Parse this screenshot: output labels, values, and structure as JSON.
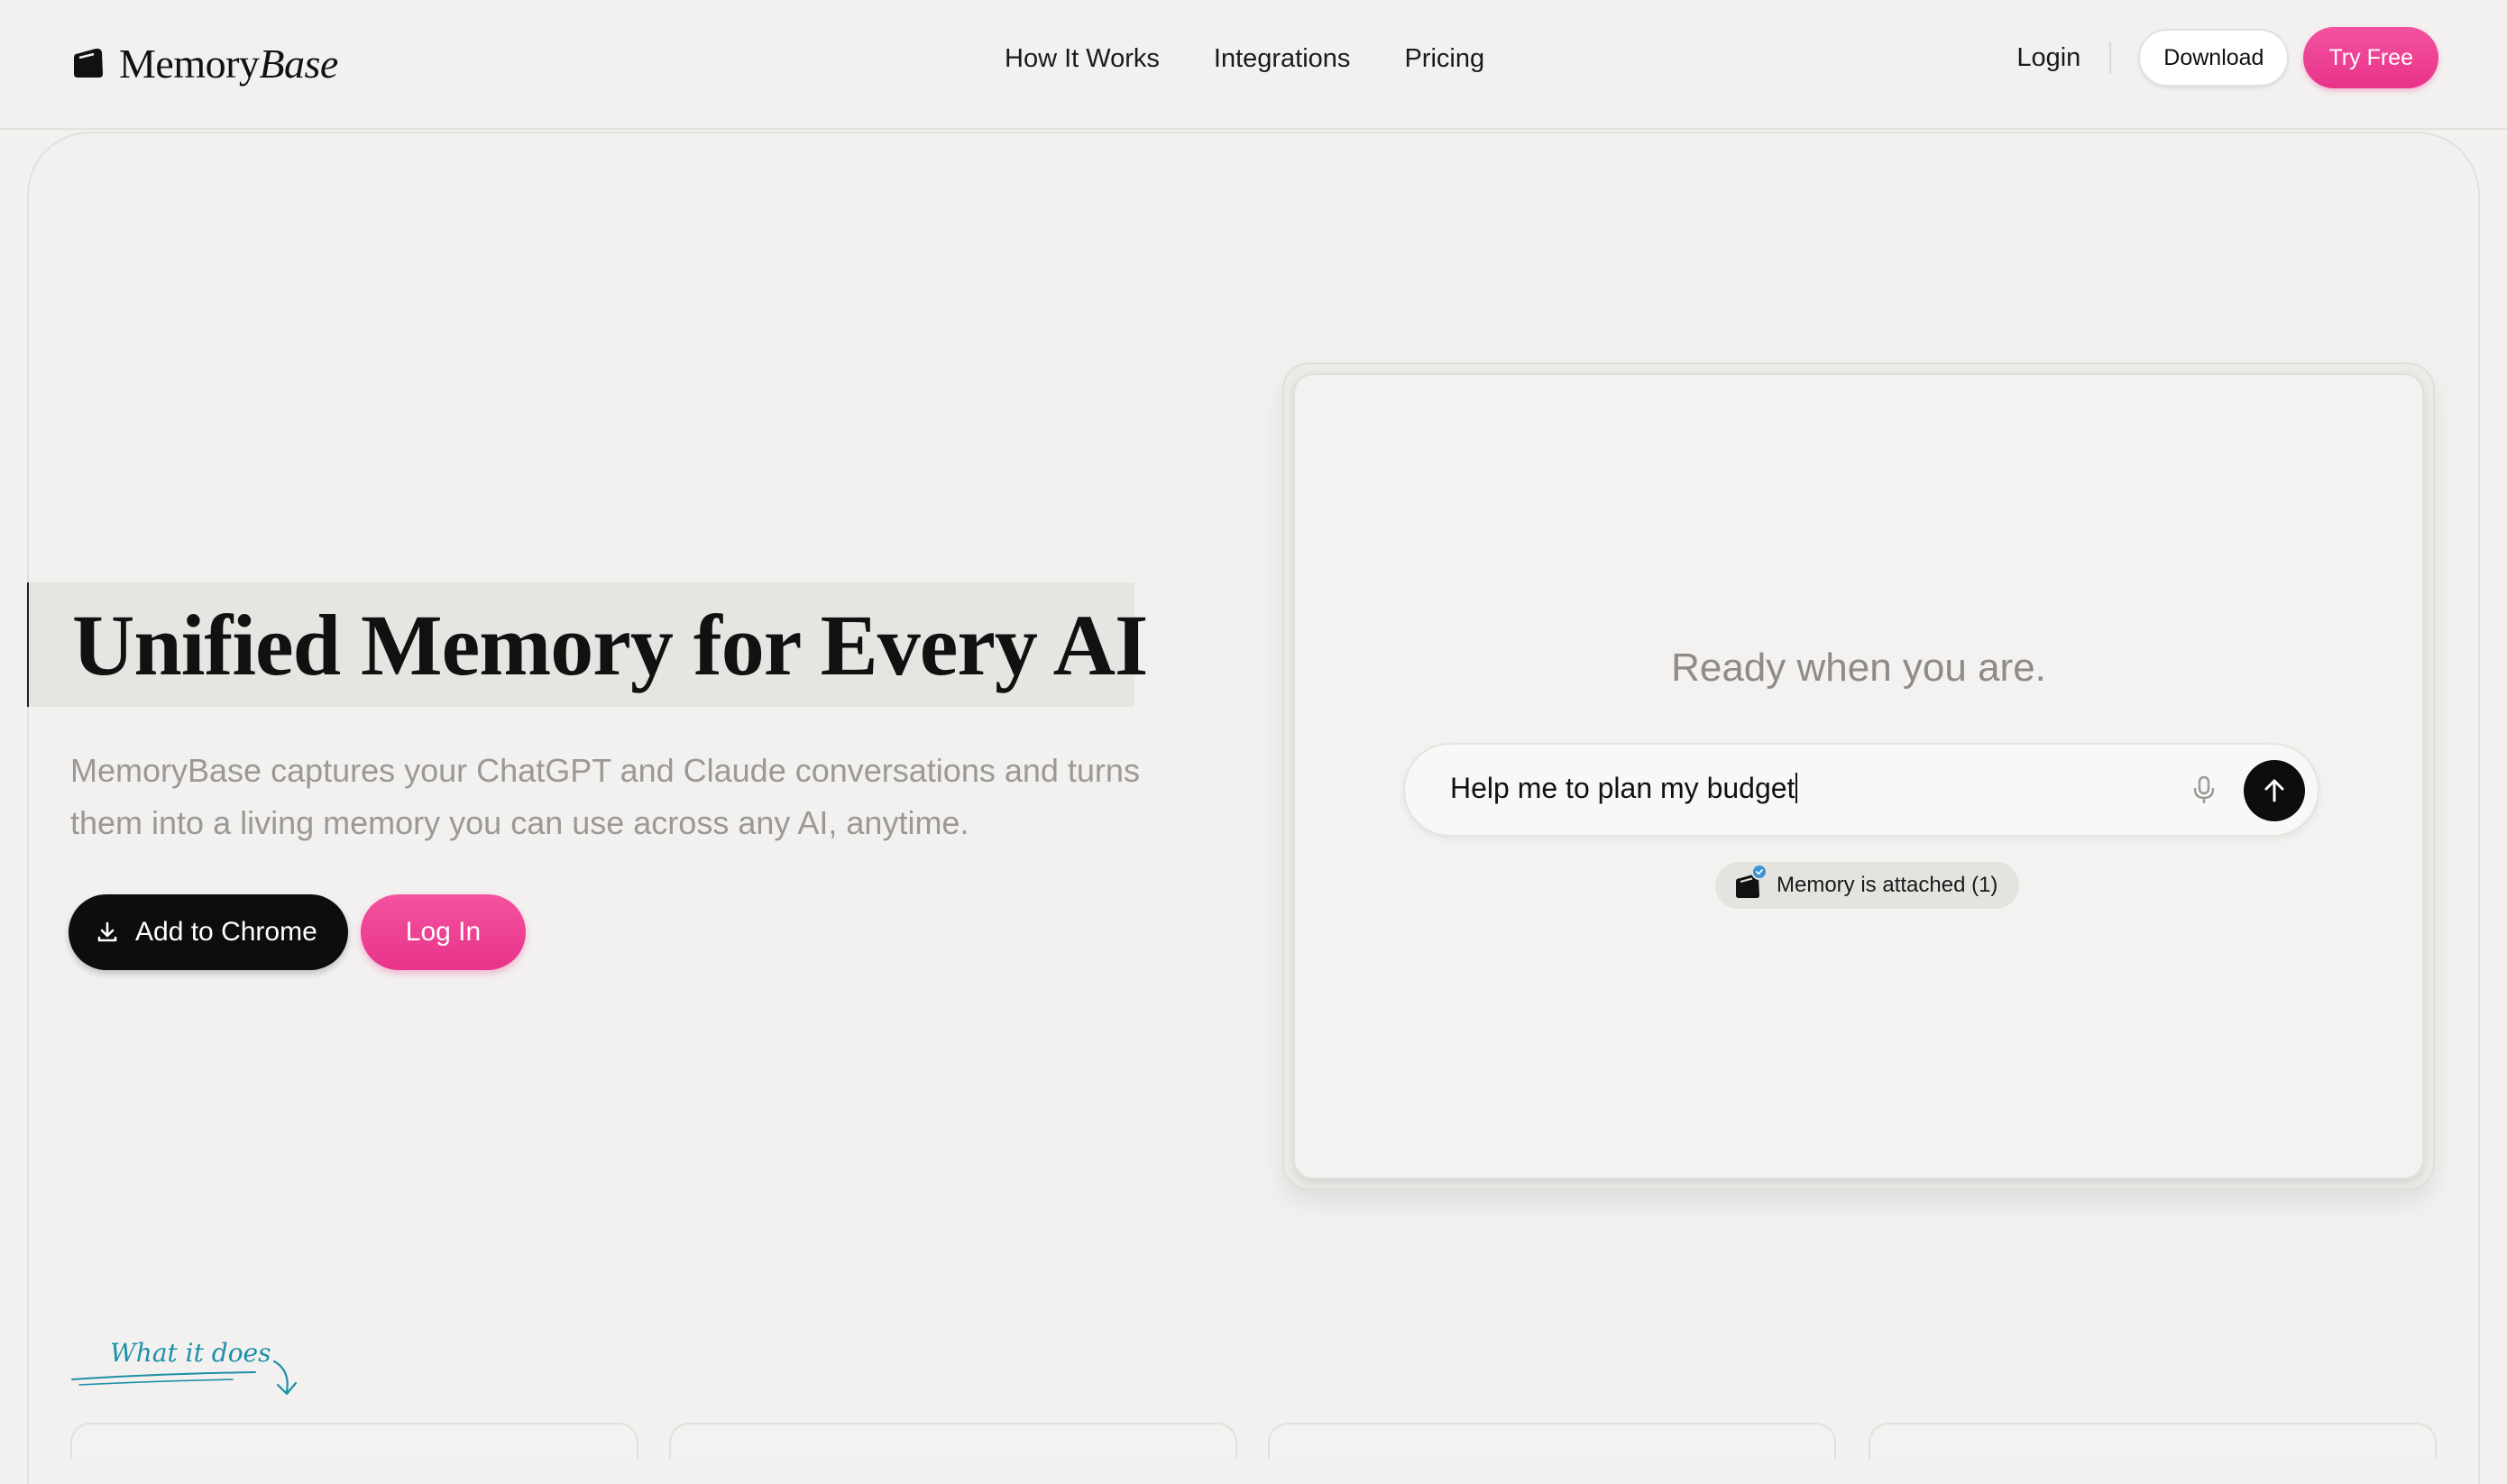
{
  "brand": {
    "name_part1": "Memory",
    "name_part2": "Base",
    "logo_icon": "memory-card-icon"
  },
  "nav": {
    "links": [
      "How It Works",
      "Integrations",
      "Pricing"
    ],
    "login_label": "Login",
    "download_label": "Download",
    "try_free_label": "Try Free"
  },
  "hero": {
    "title": "Unified Memory for Every AI",
    "subtitle": "MemoryBase captures your ChatGPT and Claude conversations and turns them into a living memory you can use across any AI, anytime.",
    "primary_cta": "Add to Chrome",
    "primary_cta_icon": "download-icon",
    "secondary_cta": "Log In"
  },
  "demo": {
    "heading": "Ready when you are.",
    "input_value": "Help me to plan my budget",
    "mic_icon": "microphone-icon",
    "send_icon": "arrow-up-icon",
    "memory_pill_label": "Memory is attached (1)"
  },
  "section": {
    "tag_label": "What it does"
  },
  "colors": {
    "accent_pink": "#e8338a",
    "tag_teal": "#1d8fa8",
    "background": "#f2f1ef",
    "dark": "#0d0d0d"
  }
}
